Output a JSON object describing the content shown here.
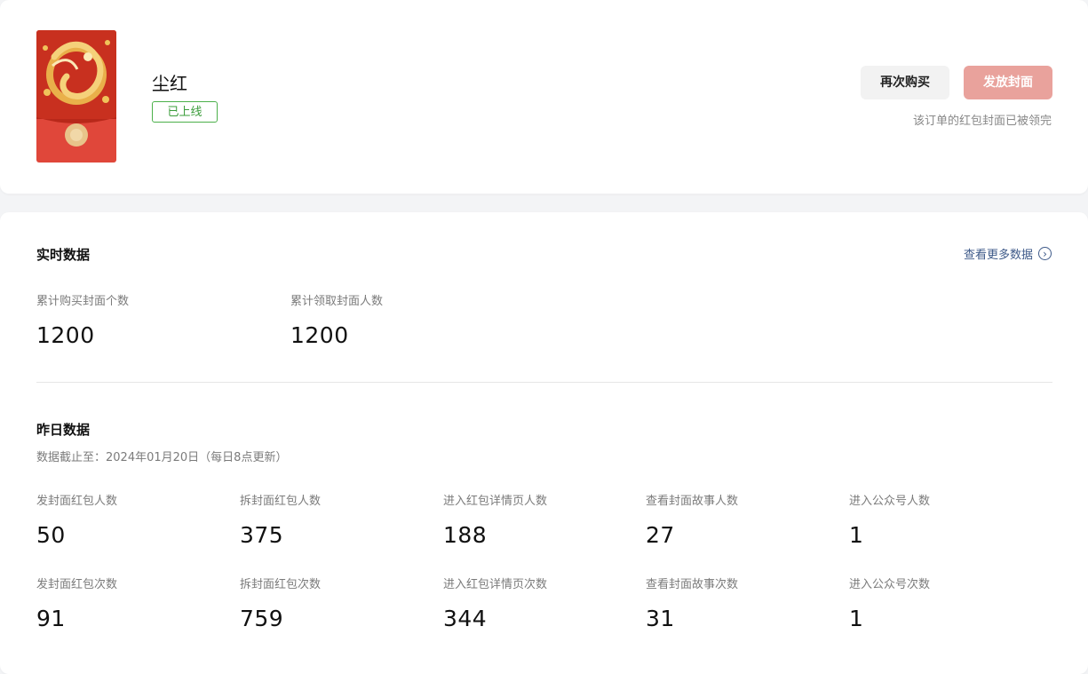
{
  "order": {
    "title": "尘红",
    "status": "已上线",
    "rebuy_label": "再次购买",
    "issue_label": "发放封面",
    "notice": "该订单的红包封面已被领完",
    "cover_icon": "dragon-red-envelope-cover",
    "colors": {
      "cover_red": "#e0473a",
      "status_green": "#4bb04a",
      "issue_button": "#e9a29c"
    }
  },
  "realtime": {
    "title": "实时数据",
    "more_label": "查看更多数据",
    "metrics": [
      {
        "label": "累计购买封面个数",
        "value": "1200"
      },
      {
        "label": "累计领取封面人数",
        "value": "1200"
      }
    ]
  },
  "yesterday": {
    "title": "昨日数据",
    "subtitle": "数据截止至：2024年01月20日（每日8点更新）",
    "row1": [
      {
        "label": "发封面红包人数",
        "value": "50"
      },
      {
        "label": "拆封面红包人数",
        "value": "375"
      },
      {
        "label": "进入红包详情页人数",
        "value": "188"
      },
      {
        "label": "查看封面故事人数",
        "value": "27"
      },
      {
        "label": "进入公众号人数",
        "value": "1"
      }
    ],
    "row2": [
      {
        "label": "发封面红包次数",
        "value": "91"
      },
      {
        "label": "拆封面红包次数",
        "value": "759"
      },
      {
        "label": "进入红包详情页次数",
        "value": "344"
      },
      {
        "label": "查看封面故事次数",
        "value": "31"
      },
      {
        "label": "进入公众号次数",
        "value": "1"
      }
    ]
  }
}
